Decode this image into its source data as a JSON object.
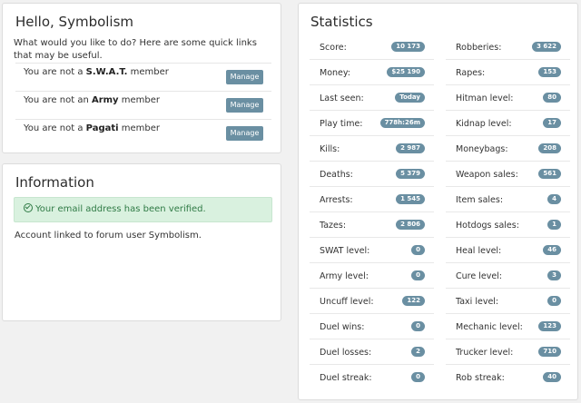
{
  "hello": {
    "title": "Hello, Symbolism",
    "intro": "What would you like to do? Here are some quick links that may be useful.",
    "memberships": [
      {
        "prefix": "You are not a ",
        "group": "S.W.A.T.",
        "suffix": " member",
        "button": "Manage"
      },
      {
        "prefix": "You are not an ",
        "group": "Army",
        "suffix": " member",
        "button": "Manage"
      },
      {
        "prefix": "You are not a ",
        "group": "Pagati",
        "suffix": " member",
        "button": "Manage"
      }
    ]
  },
  "information": {
    "title": "Information",
    "alert": "Your email address has been verified.",
    "linked": "Account linked to forum user Symbolism."
  },
  "statistics": {
    "title": "Statistics",
    "left": [
      {
        "label": "Score:",
        "value": "10 173"
      },
      {
        "label": "Money:",
        "value": "$25 190"
      },
      {
        "label": "Last seen:",
        "value": "Today"
      },
      {
        "label": "Play time:",
        "value": "778h:26m"
      },
      {
        "label": "Kills:",
        "value": "2 987"
      },
      {
        "label": "Deaths:",
        "value": "5 379"
      },
      {
        "label": "Arrests:",
        "value": "1 545"
      },
      {
        "label": "Tazes:",
        "value": "2 806"
      },
      {
        "label": "SWAT level:",
        "value": "0"
      },
      {
        "label": "Army level:",
        "value": "0"
      },
      {
        "label": "Uncuff level:",
        "value": "122"
      },
      {
        "label": "Duel wins:",
        "value": "0"
      },
      {
        "label": "Duel losses:",
        "value": "2"
      },
      {
        "label": "Duel streak:",
        "value": "0"
      }
    ],
    "right": [
      {
        "label": "Robberies:",
        "value": "3 622"
      },
      {
        "label": "Rapes:",
        "value": "153"
      },
      {
        "label": "Hitman level:",
        "value": "80"
      },
      {
        "label": "Kidnap level:",
        "value": "17"
      },
      {
        "label": "Moneybags:",
        "value": "208"
      },
      {
        "label": "Weapon sales:",
        "value": "561"
      },
      {
        "label": "Item sales:",
        "value": "4"
      },
      {
        "label": "Hotdogs sales:",
        "value": "1"
      },
      {
        "label": "Heal level:",
        "value": "46"
      },
      {
        "label": "Cure level:",
        "value": "3"
      },
      {
        "label": "Taxi level:",
        "value": "0"
      },
      {
        "label": "Mechanic level:",
        "value": "123"
      },
      {
        "label": "Trucker level:",
        "value": "710"
      },
      {
        "label": "Rob streak:",
        "value": "40"
      }
    ]
  },
  "colors": {
    "badge": "#6a8fa2",
    "alert_bg": "#d9f1df",
    "alert_text": "#2f7a45"
  },
  "icons": {
    "verified": "check-circle-icon"
  }
}
